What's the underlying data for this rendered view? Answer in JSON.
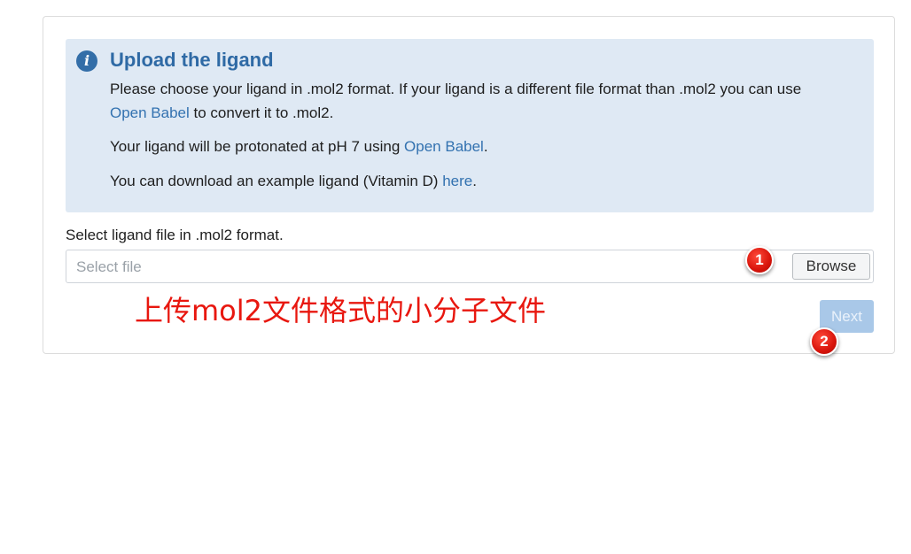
{
  "info": {
    "icon": "info-icon",
    "icon_glyph": "i",
    "title": "Upload the ligand",
    "line1_text": "Please choose your ligand in .mol2 format. If your ligand is a different file format than .mol2 you can use",
    "line2_link": "Open Babel",
    "line2_text": " to convert it to .mol2.",
    "line3_text": "Your ligand will be protonated at pH 7 using ",
    "line3_link": "Open Babel",
    "line3_end": ".",
    "line4_text": "You can download an example ligand (Vitamin D) ",
    "line4_link": "here",
    "line4_end": "."
  },
  "form": {
    "label": "Select ligand file in .mol2 format.",
    "placeholder": "Select file",
    "browse_label": "Browse",
    "next_label": "Next"
  },
  "annotations": {
    "text": "上传mol2文件格式的小分子文件",
    "marker1": "1",
    "marker2": "2",
    "color": "#e8170f"
  },
  "colors": {
    "info_bg": "#dfe9f4",
    "title": "#2f6aa5",
    "link": "#3372b0",
    "next_bg": "#a9c8e8"
  }
}
